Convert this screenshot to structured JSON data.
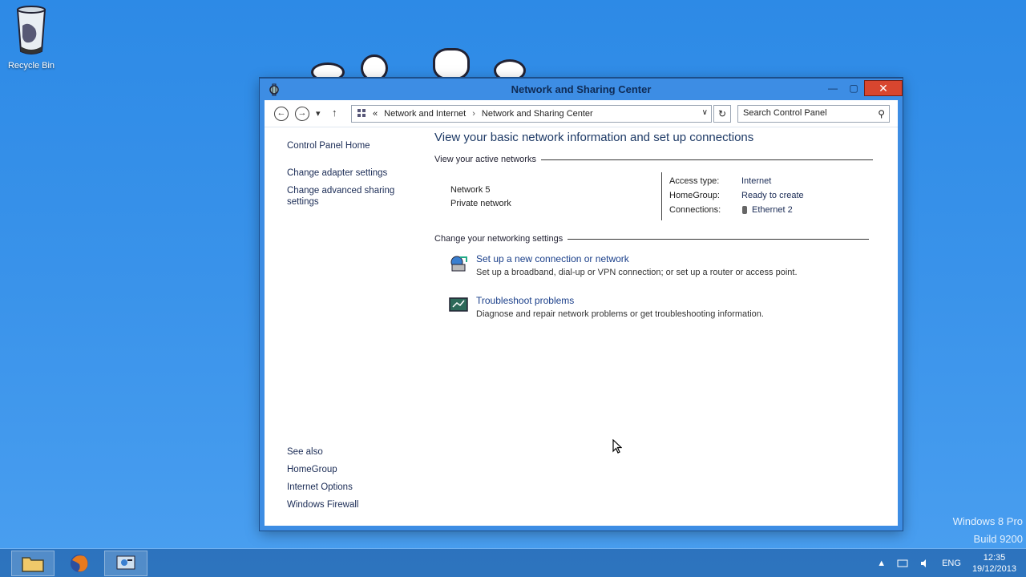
{
  "desktop": {
    "recycle_bin_label": "Recycle Bin",
    "watermark_line1": "Windows 8 Pro",
    "watermark_line2": "Build 9200"
  },
  "window": {
    "title": "Network and Sharing Center",
    "controls": {
      "minimize": "—",
      "maximize": "▢",
      "close": "✕"
    }
  },
  "nav": {
    "back_icon": "←",
    "forward_icon": "→",
    "recent_icon": "▾",
    "up_icon": "↑",
    "breadcrumb": [
      "Network and Internet",
      "Network and Sharing Center"
    ],
    "overflow": "«",
    "address_dropdown": "∨",
    "refresh_icon": "↻",
    "search_placeholder": "Search Control Panel",
    "search_icon": "⚲"
  },
  "left_pane": {
    "home": "Control Panel Home",
    "links": [
      "Change adapter settings",
      "Change advanced sharing",
      "settings"
    ],
    "see_also_title": "See also",
    "see_also": [
      "HomeGroup",
      "Internet Options",
      "Windows Firewall"
    ]
  },
  "main": {
    "heading": "View your basic network information and set up connections",
    "active_networks_label": "View your active networks",
    "network_name": "Network  5",
    "network_type": "Private network",
    "props": [
      {
        "key": "Access type:",
        "value": "Internet"
      },
      {
        "key": "HomeGroup:",
        "value": "Ready to create"
      },
      {
        "key": "Connections:",
        "value": "Ethernet 2"
      }
    ],
    "change_settings_label": "Change your networking settings",
    "tasks": [
      {
        "title": "Set up a new connection or network",
        "desc": "Set up a broadband, dial-up or VPN connection; or set up a router or access point."
      },
      {
        "title": "Troubleshoot problems",
        "desc": "Diagnose and repair network problems or get troubleshooting information."
      }
    ]
  },
  "taskbar": {
    "tray_arrow": "▲",
    "language": "ENG",
    "time": "12:35",
    "date": "19/12/2013"
  },
  "colors": {
    "desktop": "#3a93ea",
    "window_frame": "#3d8de4",
    "close": "#d8462f",
    "link": "#1a3f8a"
  }
}
